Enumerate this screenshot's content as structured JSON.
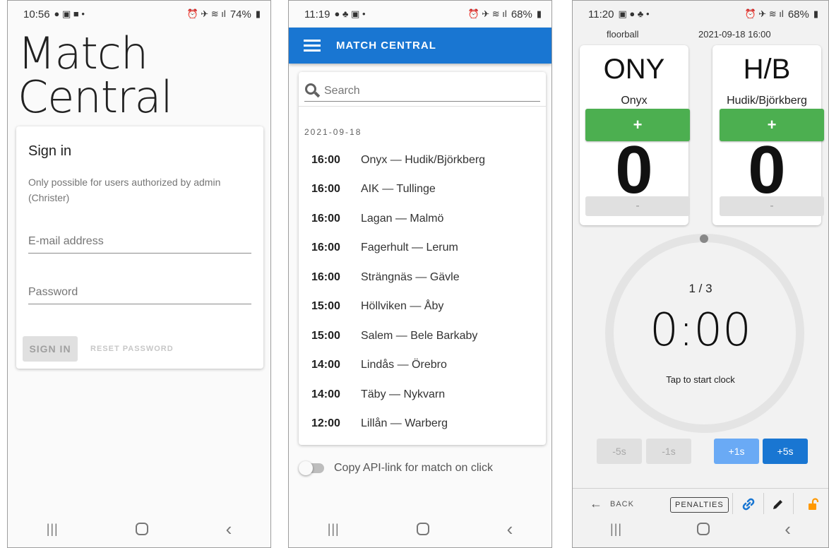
{
  "screen1": {
    "status": {
      "time": "10:56",
      "battery": "74%"
    },
    "app_title_line1": "Match",
    "app_title_line2": "Central",
    "signin": {
      "title": "Sign in",
      "description": "Only possible for users authorized by admin (Christer)",
      "email_placeholder": "E-mail address",
      "password_placeholder": "Password",
      "signin_label": "SIGN IN",
      "reset_label": "RESET PASSWORD"
    }
  },
  "screen2": {
    "status": {
      "time": "11:19",
      "battery": "68%"
    },
    "appbar_title": "MATCH CENTRAL",
    "search_placeholder": "Search",
    "date_heading": "2021-09-18",
    "matches": [
      {
        "time": "16:00",
        "teams": "Onyx — Hudik/Björkberg"
      },
      {
        "time": "16:00",
        "teams": "AIK — Tullinge"
      },
      {
        "time": "16:00",
        "teams": "Lagan — Malmö"
      },
      {
        "time": "16:00",
        "teams": "Fagerhult — Lerum"
      },
      {
        "time": "16:00",
        "teams": "Strängnäs — Gävle"
      },
      {
        "time": "15:00",
        "teams": "Höllviken — Åby"
      },
      {
        "time": "15:00",
        "teams": "Salem — Bele Barkaby"
      },
      {
        "time": "14:00",
        "teams": "Lindås — Örebro"
      },
      {
        "time": "14:00",
        "teams": "Täby — Nykvarn"
      },
      {
        "time": "12:00",
        "teams": "Lillån — Warberg"
      }
    ],
    "toggle_label": "Copy API-link for match on click",
    "toggle_on": false
  },
  "screen3": {
    "status": {
      "time": "11:20",
      "battery": "68%"
    },
    "sport": "floorball",
    "datetime": "2021-09-18 16:00",
    "home": {
      "abbr": "ONY",
      "name": "Onyx",
      "score": "0",
      "plus": "+",
      "minus": "-"
    },
    "away": {
      "abbr": "H/B",
      "name": "Hudik/Björkberg",
      "score": "0",
      "plus": "+",
      "minus": "-"
    },
    "period": "1 / 3",
    "clock": "0:00",
    "clock_hint": "Tap to start clock",
    "adjust": {
      "minus5": "-5s",
      "minus1": "-1s",
      "plus1": "+1s",
      "plus5": "+5s"
    },
    "back_label": "BACK",
    "penalties_label": "PENALTIES",
    "colors": {
      "accent": "#1976d2",
      "green": "#4caf50",
      "lock": "#ff9800"
    }
  }
}
